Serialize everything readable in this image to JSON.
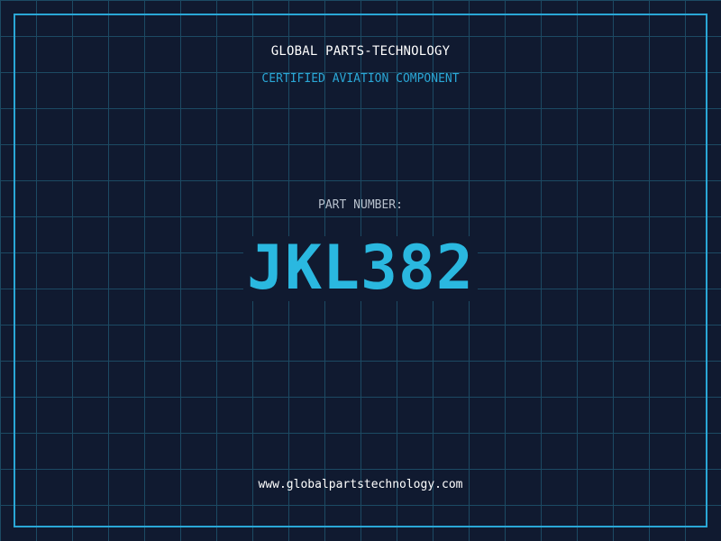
{
  "header": {
    "company": "GLOBAL PARTS-TECHNOLOGY",
    "subtitle": "CERTIFIED AVIATION COMPONENT"
  },
  "main": {
    "label": "PART NUMBER:",
    "part_number": "JKL382"
  },
  "footer": {
    "website": "www.globalpartstechnology.com"
  },
  "colors": {
    "background": "#101a30",
    "grid": "#1c4a63",
    "accent": "#2aa7d6",
    "part_number": "#2ab8e0",
    "label": "#b7c0cc",
    "text": "#ffffff"
  }
}
